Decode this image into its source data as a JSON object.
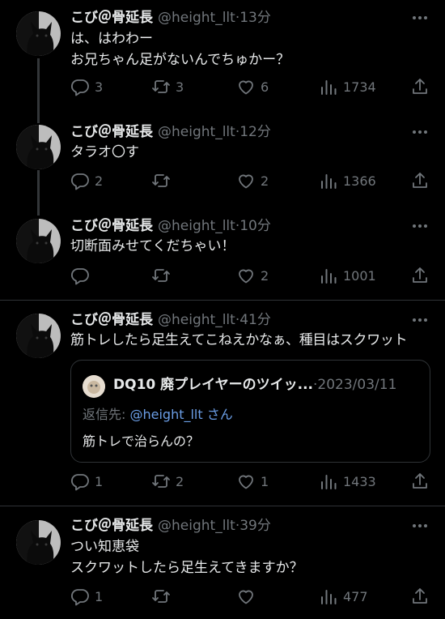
{
  "tweets": [
    {
      "name": "こび＠骨延長",
      "handle": "@height_llt",
      "sep": "·",
      "time": "13分",
      "lines": [
        "は、はわわー",
        "お兄ちゃん足がないんでちゅかー？"
      ],
      "replies": "3",
      "retweets": "3",
      "likes": "6",
      "views": "1734"
    },
    {
      "name": "こび＠骨延長",
      "handle": "@height_llt",
      "sep": "·",
      "time": "12分",
      "lines": [
        "タラオ〇す"
      ],
      "replies": "2",
      "retweets": "",
      "likes": "2",
      "views": "1366"
    },
    {
      "name": "こび＠骨延長",
      "handle": "@height_llt",
      "sep": "·",
      "time": "10分",
      "lines": [
        "切断面みせてくだちゃい！"
      ],
      "replies": "",
      "retweets": "",
      "likes": "2",
      "views": "1001"
    },
    {
      "name": "こび＠骨延長",
      "handle": "@height_llt",
      "sep": "·",
      "time": "41分",
      "lines": [
        "筋トレしたら足生えてこねえかなぁ、種目はスクワット"
      ],
      "quote": {
        "name": "DQ10 廃プレイヤーのツイッ...",
        "sep": "·",
        "date": "2023/03/11",
        "reply_prefix": "返信先: ",
        "reply_mention": "@height_llt",
        "reply_suffix": " さん",
        "text": "筋トレで治らんの？"
      },
      "replies": "1",
      "retweets": "2",
      "likes": "1",
      "views": "1433"
    },
    {
      "name": "こび＠骨延長",
      "handle": "@height_llt",
      "sep": "·",
      "time": "39分",
      "lines": [
        "つい知恵袋",
        "スクワットしたら足生えてきますか？"
      ],
      "replies": "1",
      "retweets": "",
      "likes": "",
      "views": "477"
    }
  ],
  "colors": {
    "background": "#000000",
    "text": "#e7e9ea",
    "muted": "#71767b",
    "mention": "#6b9ee6",
    "divider": "#2f3336"
  },
  "icons": [
    "reply-icon",
    "retweet-icon",
    "like-icon",
    "views-icon",
    "share-icon",
    "more-icon"
  ]
}
